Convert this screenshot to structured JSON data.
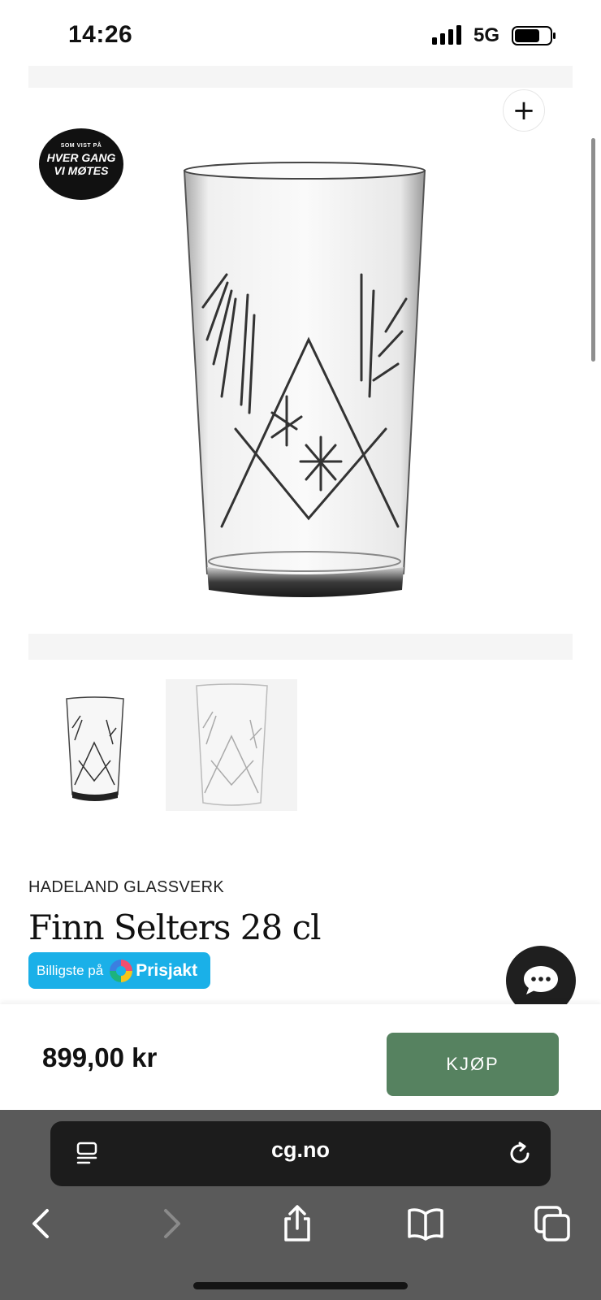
{
  "status_bar": {
    "time": "14:26",
    "network": "5G"
  },
  "product": {
    "badge_small": "SOM VIST PÅ",
    "badge_line1": "HVER GANG",
    "badge_line2": "VI MØTES",
    "brand": "HADELAND GLASSVERK",
    "title": "Finn Selters 28 cl",
    "price": "899,00 kr",
    "buy_label": "KJØP",
    "zoom_icon": "plus-icon"
  },
  "prisjakt": {
    "prefix": "Billigste på",
    "name": "Prisjakt"
  },
  "colors": {
    "buy_button": "#568260",
    "prisjakt": "#1ab0e8",
    "chat_button": "#1f1f1f"
  },
  "browser": {
    "url": "cg.no",
    "icons": [
      "reader-icon",
      "reload-icon",
      "back-icon",
      "forward-icon",
      "share-icon",
      "bookmarks-icon",
      "tabs-icon"
    ]
  }
}
